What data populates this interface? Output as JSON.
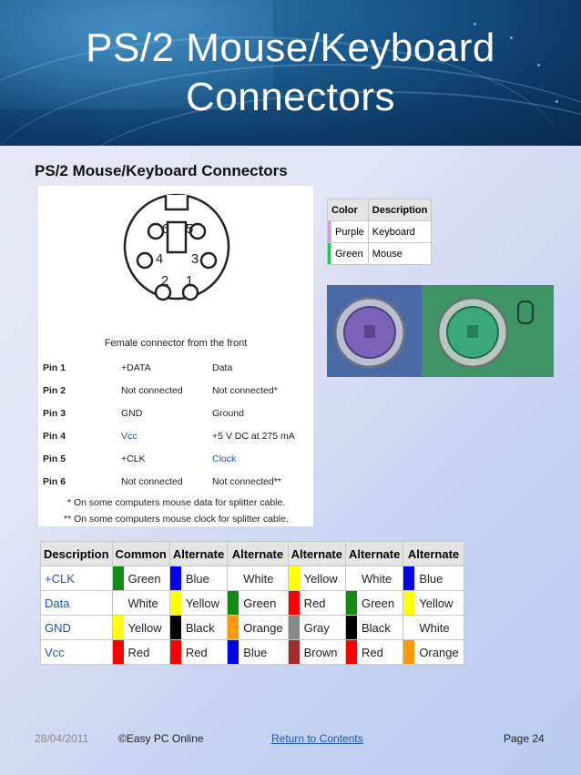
{
  "header": {
    "title_line1": "PS/2 Mouse/Keyboard",
    "title_line2": "Connectors"
  },
  "subtitle": "PS/2 Mouse/Keyboard Connectors",
  "pin_diagram": {
    "numbers": [
      "6",
      "5",
      "4",
      "3",
      "2",
      "1"
    ],
    "caption": "Female connector from the front"
  },
  "pins": [
    {
      "pin": "Pin 1",
      "signal": "+DATA",
      "desc": "Data"
    },
    {
      "pin": "Pin 2",
      "signal": "Not connected",
      "desc": "Not connected*"
    },
    {
      "pin": "Pin 3",
      "signal": "GND",
      "desc": "Ground"
    },
    {
      "pin": "Pin 4",
      "signal": "Vcc",
      "desc": "+5 V DC at 275 mA"
    },
    {
      "pin": "Pin 5",
      "signal": "+CLK",
      "desc": "Clock"
    },
    {
      "pin": "Pin 6",
      "signal": "Not connected",
      "desc": "Not connected**"
    }
  ],
  "notes": [
    "* On some computers mouse data for splitter cable.",
    "** On some computers mouse clock for splitter cable."
  ],
  "color_table": {
    "headers": [
      "Color",
      "Description"
    ],
    "rows": [
      {
        "color": "Purple",
        "swatch": "#c9a0e8",
        "desc": "Keyboard"
      },
      {
        "color": "Green",
        "swatch": "#22c55e",
        "desc": "Mouse"
      }
    ]
  },
  "alt_table": {
    "headers": [
      "Description",
      "Common",
      "Alternate",
      "Alternate",
      "Alternate",
      "Alternate",
      "Alternate"
    ],
    "rows": [
      {
        "desc": "+CLK",
        "cells": [
          {
            "name": "Green",
            "swatch": "#138a13"
          },
          {
            "name": "Blue",
            "swatch": "#0000ee"
          },
          {
            "name": "White",
            "swatch": "#ffffff"
          },
          {
            "name": "Yellow",
            "swatch": "#ffff00"
          },
          {
            "name": "White",
            "swatch": "#ffffff"
          },
          {
            "name": "Blue",
            "swatch": "#0000ee"
          }
        ]
      },
      {
        "desc": "Data",
        "cells": [
          {
            "name": "White",
            "swatch": "#ffffff"
          },
          {
            "name": "Yellow",
            "swatch": "#ffff00"
          },
          {
            "name": "Green",
            "swatch": "#138a13"
          },
          {
            "name": "Red",
            "swatch": "#ff0000"
          },
          {
            "name": "Green",
            "swatch": "#138a13"
          },
          {
            "name": "Yellow",
            "swatch": "#ffff00"
          }
        ]
      },
      {
        "desc": "GND",
        "cells": [
          {
            "name": "Yellow",
            "swatch": "#ffff00"
          },
          {
            "name": "Black",
            "swatch": "#000000"
          },
          {
            "name": "Orange",
            "swatch": "#ff9900"
          },
          {
            "name": "Gray",
            "swatch": "#888888"
          },
          {
            "name": "Black",
            "swatch": "#000000"
          },
          {
            "name": "White",
            "swatch": "#ffffff"
          }
        ]
      },
      {
        "desc": "Vcc",
        "cells": [
          {
            "name": "Red",
            "swatch": "#ff0000"
          },
          {
            "name": "Red",
            "swatch": "#ff0000"
          },
          {
            "name": "Blue",
            "swatch": "#0000ee"
          },
          {
            "name": "Brown",
            "swatch": "#a52a2a"
          },
          {
            "name": "Red",
            "swatch": "#ff0000"
          },
          {
            "name": "Orange",
            "swatch": "#ff9900"
          }
        ]
      }
    ]
  },
  "footer": {
    "date": "28/04/2011",
    "copyright": "©Easy PC Online",
    "link": "Return to Contents",
    "page": "Page 24"
  }
}
